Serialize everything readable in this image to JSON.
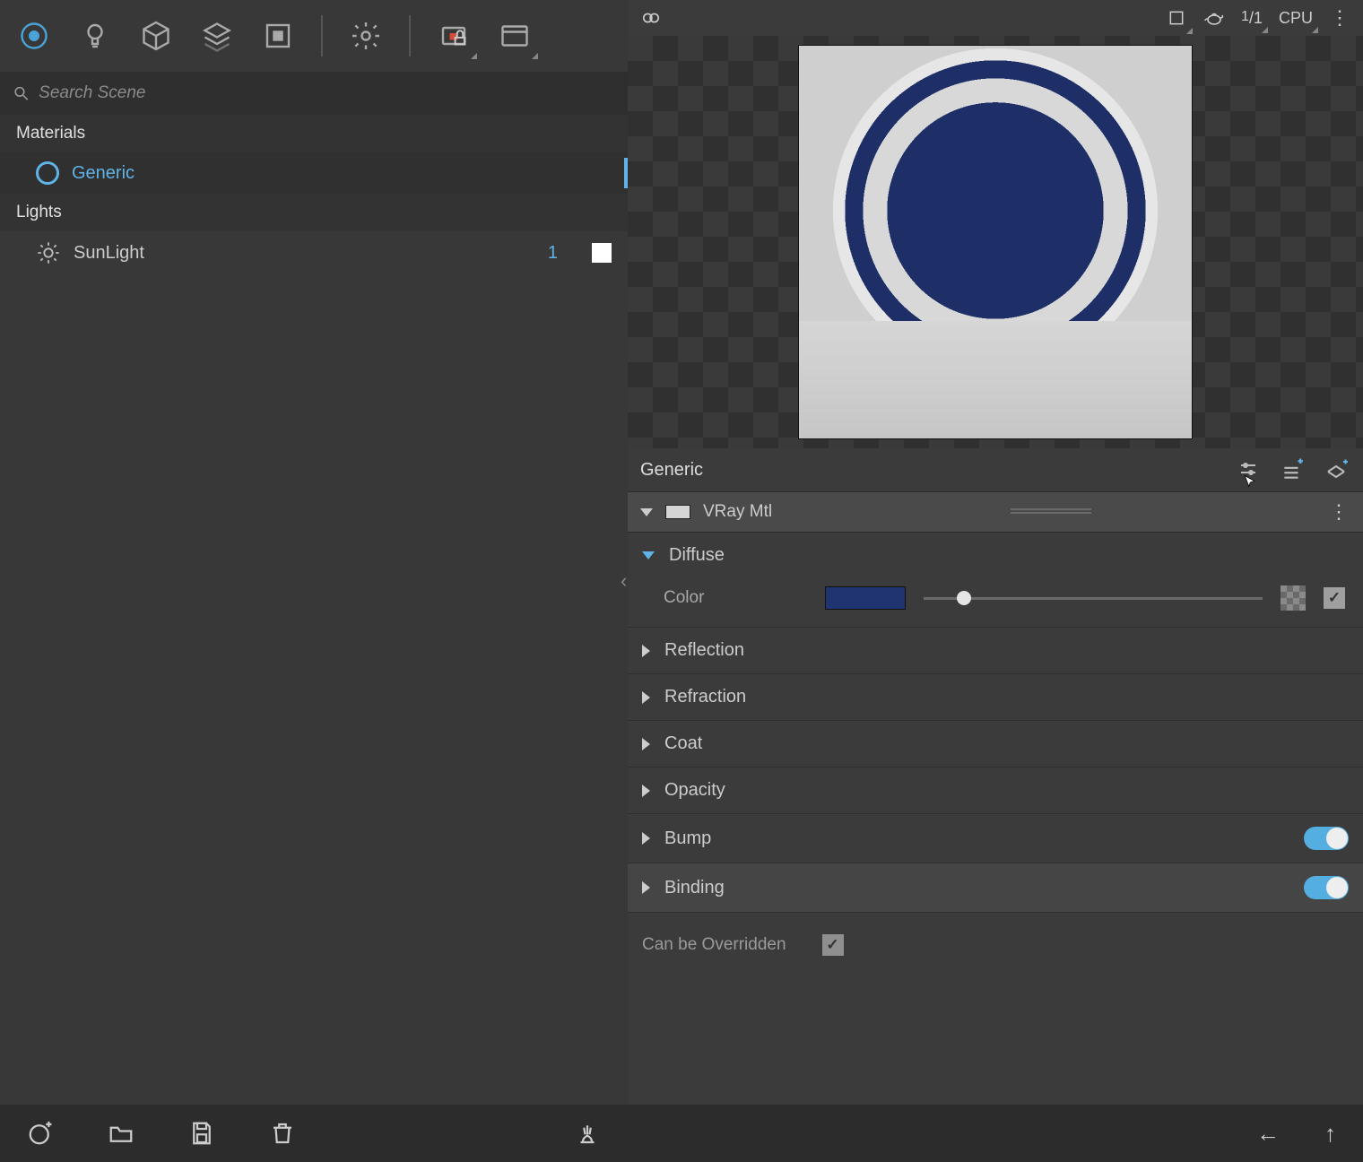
{
  "left": {
    "search_placeholder": "Search Scene",
    "category_materials": "Materials",
    "category_lights": "Lights",
    "materials": [
      {
        "name": "Generic"
      }
    ],
    "lights": [
      {
        "name": "SunLight",
        "count": "1",
        "color": "#ffffff"
      }
    ]
  },
  "preview": {
    "ratio_num": "1",
    "ratio_den": "1",
    "engine": "CPU"
  },
  "material": {
    "name": "Generic",
    "type": "VRay Mtl",
    "sections": {
      "diffuse": {
        "title": "Diffuse",
        "color_label": "Color",
        "color_value": "#1f3470",
        "slider_pct": 12
      },
      "reflection": {
        "title": "Reflection"
      },
      "refraction": {
        "title": "Refraction"
      },
      "coat": {
        "title": "Coat"
      },
      "opacity": {
        "title": "Opacity"
      },
      "bump": {
        "title": "Bump",
        "enabled": true
      },
      "binding": {
        "title": "Binding",
        "enabled": true
      }
    },
    "overridden_label": "Can be Overridden",
    "overridden": true
  }
}
